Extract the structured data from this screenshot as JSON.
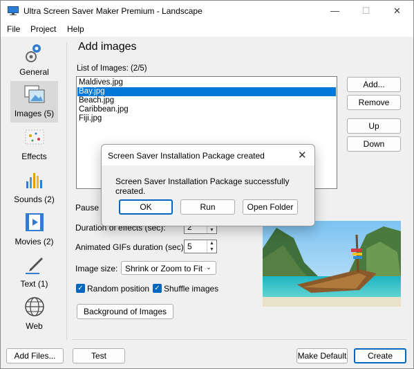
{
  "window": {
    "title": "Ultra Screen Saver Maker Premium - Landscape"
  },
  "menu": [
    "File",
    "Project",
    "Help"
  ],
  "sidebar": {
    "items": [
      {
        "label": "General",
        "icon": "gear-icon"
      },
      {
        "label": "Images (5)",
        "icon": "images-icon"
      },
      {
        "label": "Effects",
        "icon": "effects-icon"
      },
      {
        "label": "Sounds (2)",
        "icon": "sounds-icon"
      },
      {
        "label": "Movies (2)",
        "icon": "movies-icon"
      },
      {
        "label": "Text (1)",
        "icon": "text-icon"
      },
      {
        "label": "Web",
        "icon": "globe-icon"
      }
    ]
  },
  "main": {
    "title": "Add images",
    "list_label": "List of Images:  (2/5)",
    "images": [
      "Maldives.jpg",
      "Bay.jpg",
      "Beach.jpg",
      "Caribbean.jpg",
      "Fiji.jpg"
    ],
    "selected_index": 1,
    "buttons": {
      "add": "Add...",
      "remove": "Remove",
      "up": "Up",
      "down": "Down"
    },
    "pause_label": "Pause a",
    "duration_label": "Duration of effects (sec):",
    "duration_value": "2",
    "gif_label": "Animated GIFs duration (sec):",
    "gif_value": "5",
    "image_size_label": "Image size:",
    "image_size_value": "Shrink or Zoom to Fit",
    "random_position": "Random position",
    "shuffle_images": "Shuffle images",
    "background_button": "Background of Images"
  },
  "bottom": {
    "add_files": "Add Files...",
    "test": "Test",
    "make_default": "Make Default",
    "create": "Create"
  },
  "dialog": {
    "title": "Screen Saver Installation Package created",
    "message": "Screen Saver Installation Package successfully created.",
    "ok": "OK",
    "run": "Run",
    "open_folder": "Open Folder"
  },
  "colors": {
    "accent": "#0078d7",
    "selection": "#0078d7"
  }
}
